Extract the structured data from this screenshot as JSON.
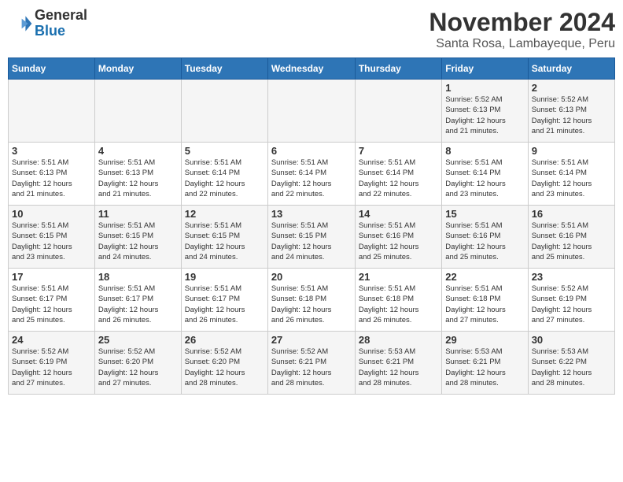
{
  "header": {
    "logo_line1": "General",
    "logo_line2": "Blue",
    "month": "November 2024",
    "location": "Santa Rosa, Lambayeque, Peru"
  },
  "weekdays": [
    "Sunday",
    "Monday",
    "Tuesday",
    "Wednesday",
    "Thursday",
    "Friday",
    "Saturday"
  ],
  "weeks": [
    [
      {
        "day": "",
        "info": ""
      },
      {
        "day": "",
        "info": ""
      },
      {
        "day": "",
        "info": ""
      },
      {
        "day": "",
        "info": ""
      },
      {
        "day": "",
        "info": ""
      },
      {
        "day": "1",
        "info": "Sunrise: 5:52 AM\nSunset: 6:13 PM\nDaylight: 12 hours\nand 21 minutes."
      },
      {
        "day": "2",
        "info": "Sunrise: 5:52 AM\nSunset: 6:13 PM\nDaylight: 12 hours\nand 21 minutes."
      }
    ],
    [
      {
        "day": "3",
        "info": "Sunrise: 5:51 AM\nSunset: 6:13 PM\nDaylight: 12 hours\nand 21 minutes."
      },
      {
        "day": "4",
        "info": "Sunrise: 5:51 AM\nSunset: 6:13 PM\nDaylight: 12 hours\nand 21 minutes."
      },
      {
        "day": "5",
        "info": "Sunrise: 5:51 AM\nSunset: 6:14 PM\nDaylight: 12 hours\nand 22 minutes."
      },
      {
        "day": "6",
        "info": "Sunrise: 5:51 AM\nSunset: 6:14 PM\nDaylight: 12 hours\nand 22 minutes."
      },
      {
        "day": "7",
        "info": "Sunrise: 5:51 AM\nSunset: 6:14 PM\nDaylight: 12 hours\nand 22 minutes."
      },
      {
        "day": "8",
        "info": "Sunrise: 5:51 AM\nSunset: 6:14 PM\nDaylight: 12 hours\nand 23 minutes."
      },
      {
        "day": "9",
        "info": "Sunrise: 5:51 AM\nSunset: 6:14 PM\nDaylight: 12 hours\nand 23 minutes."
      }
    ],
    [
      {
        "day": "10",
        "info": "Sunrise: 5:51 AM\nSunset: 6:15 PM\nDaylight: 12 hours\nand 23 minutes."
      },
      {
        "day": "11",
        "info": "Sunrise: 5:51 AM\nSunset: 6:15 PM\nDaylight: 12 hours\nand 24 minutes."
      },
      {
        "day": "12",
        "info": "Sunrise: 5:51 AM\nSunset: 6:15 PM\nDaylight: 12 hours\nand 24 minutes."
      },
      {
        "day": "13",
        "info": "Sunrise: 5:51 AM\nSunset: 6:15 PM\nDaylight: 12 hours\nand 24 minutes."
      },
      {
        "day": "14",
        "info": "Sunrise: 5:51 AM\nSunset: 6:16 PM\nDaylight: 12 hours\nand 25 minutes."
      },
      {
        "day": "15",
        "info": "Sunrise: 5:51 AM\nSunset: 6:16 PM\nDaylight: 12 hours\nand 25 minutes."
      },
      {
        "day": "16",
        "info": "Sunrise: 5:51 AM\nSunset: 6:16 PM\nDaylight: 12 hours\nand 25 minutes."
      }
    ],
    [
      {
        "day": "17",
        "info": "Sunrise: 5:51 AM\nSunset: 6:17 PM\nDaylight: 12 hours\nand 25 minutes."
      },
      {
        "day": "18",
        "info": "Sunrise: 5:51 AM\nSunset: 6:17 PM\nDaylight: 12 hours\nand 26 minutes."
      },
      {
        "day": "19",
        "info": "Sunrise: 5:51 AM\nSunset: 6:17 PM\nDaylight: 12 hours\nand 26 minutes."
      },
      {
        "day": "20",
        "info": "Sunrise: 5:51 AM\nSunset: 6:18 PM\nDaylight: 12 hours\nand 26 minutes."
      },
      {
        "day": "21",
        "info": "Sunrise: 5:51 AM\nSunset: 6:18 PM\nDaylight: 12 hours\nand 26 minutes."
      },
      {
        "day": "22",
        "info": "Sunrise: 5:51 AM\nSunset: 6:18 PM\nDaylight: 12 hours\nand 27 minutes."
      },
      {
        "day": "23",
        "info": "Sunrise: 5:52 AM\nSunset: 6:19 PM\nDaylight: 12 hours\nand 27 minutes."
      }
    ],
    [
      {
        "day": "24",
        "info": "Sunrise: 5:52 AM\nSunset: 6:19 PM\nDaylight: 12 hours\nand 27 minutes."
      },
      {
        "day": "25",
        "info": "Sunrise: 5:52 AM\nSunset: 6:20 PM\nDaylight: 12 hours\nand 27 minutes."
      },
      {
        "day": "26",
        "info": "Sunrise: 5:52 AM\nSunset: 6:20 PM\nDaylight: 12 hours\nand 28 minutes."
      },
      {
        "day": "27",
        "info": "Sunrise: 5:52 AM\nSunset: 6:21 PM\nDaylight: 12 hours\nand 28 minutes."
      },
      {
        "day": "28",
        "info": "Sunrise: 5:53 AM\nSunset: 6:21 PM\nDaylight: 12 hours\nand 28 minutes."
      },
      {
        "day": "29",
        "info": "Sunrise: 5:53 AM\nSunset: 6:21 PM\nDaylight: 12 hours\nand 28 minutes."
      },
      {
        "day": "30",
        "info": "Sunrise: 5:53 AM\nSunset: 6:22 PM\nDaylight: 12 hours\nand 28 minutes."
      }
    ]
  ]
}
